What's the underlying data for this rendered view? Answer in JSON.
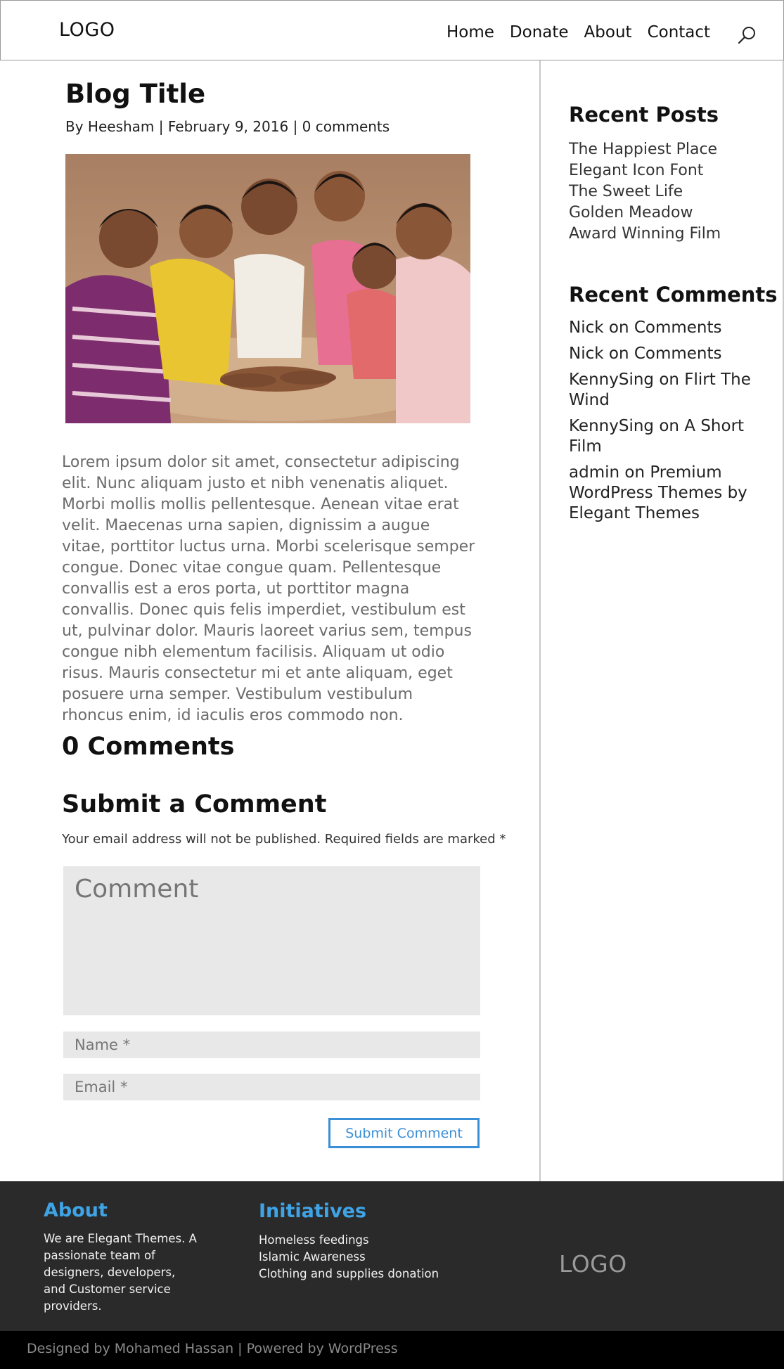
{
  "header": {
    "logo": "LOGO",
    "nav": [
      "Home",
      "Donate",
      "About",
      "Contact"
    ]
  },
  "post": {
    "title": "Blog Title",
    "meta_by": "By",
    "author": "Heesham",
    "separator": "|",
    "date": "February 9, 2016",
    "comments_link": "0 comments",
    "image_alt": "Smiling children in a circle with hands together",
    "body": "Lorem ipsum dolor sit amet, consectetur adipiscing elit. Nunc aliquam justo et nibh venenatis aliquet. Morbi mollis mollis pellentesque. Aenean vitae erat velit. Maecenas urna sapien, dignissim a augue vitae, porttitor luctus urna. Morbi scelerisque semper congue. Donec vitae congue quam. Pellentesque convallis est a eros porta, ut porttitor magna convallis. Donec quis felis imperdiet, vestibulum est ut, pulvinar dolor. Mauris laoreet varius sem, tempus congue nibh elementum facilisis. Aliquam ut odio risus. Mauris consectetur mi et ante aliquam, eget posuere urna semper. Vestibulum vestibulum rhoncus enim, id iaculis eros commodo non."
  },
  "comments": {
    "count_heading": "0 Comments",
    "submit_heading": "Submit a Comment",
    "notice": "Your email address will not be published. Required fields are marked *",
    "comment_placeholder": "Comment",
    "name_placeholder": "Name *",
    "email_placeholder": "Email *",
    "submit_label": "Submit Comment"
  },
  "sidebar": {
    "recent_posts_heading": "Recent Posts",
    "recent_posts": [
      "The Happiest Place",
      "Elegant Icon Font",
      "The Sweet Life",
      "Golden Meadow",
      "Award Winning Film"
    ],
    "recent_comments_heading": "Recent Comments",
    "recent_comments": [
      "Nick on Comments",
      "Nick on Comments",
      "KennySing on Flirt The Wind",
      "KennySing on A Short Film",
      "admin on Premium WordPress Themes by Elegant Themes"
    ]
  },
  "footer": {
    "about_heading": "About",
    "about_text": "We are Elegant Themes. A passionate team of designers, developers, and Customer service providers.",
    "initiatives_heading": "Initiatives",
    "initiatives": [
      "Homeless feedings",
      "Islamic Awareness",
      "Clothing and supplies donation"
    ],
    "logo": "LOGO",
    "credits": "Designed by Mohamed Hassan | Powered by WordPress"
  },
  "colors": {
    "accent": "#3a8fd6",
    "footer_heading": "#3fa4e6",
    "footer_bg": "#2a2a2b"
  }
}
